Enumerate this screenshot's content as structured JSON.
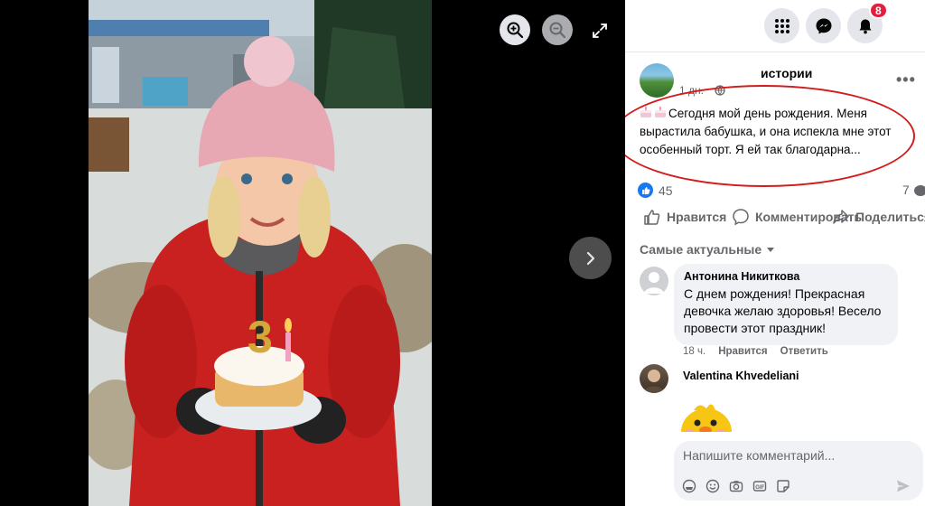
{
  "viewer": {
    "zoom_in_icon": "zoom-in-icon",
    "zoom_out_icon": "zoom-out-icon",
    "expand_icon": "expand-icon",
    "next_icon": "chevron-right-icon"
  },
  "topbar": {
    "menu_icon": "grid-menu-icon",
    "messenger_icon": "messenger-icon",
    "notifications_icon": "bell-icon",
    "notifications_count": "8"
  },
  "post": {
    "title": "истории",
    "time": "1 дн.",
    "text": "Сегодня мой день рождения. Меня вырастила бабушка, и она испекла мне этот особенный торт. Я ей так благодарна...",
    "more": "•••",
    "likes": "45",
    "comments_count": "7"
  },
  "actions": {
    "like": "Нравится",
    "comment": "Комментировать",
    "share": "Поделиться"
  },
  "comments": {
    "sort_label": "Самые актуальные",
    "items": [
      {
        "author": "Антонина Никиткова",
        "text": "С днем рождения! Прекрасная девочка желаю здоровья! Весело провести этот праздник!",
        "time": "18 ч.",
        "like": "Нравится",
        "reply": "Ответить"
      },
      {
        "author": "Valentina Khvedeliani"
      }
    ]
  },
  "composer": {
    "placeholder": "Напишите комментарий..."
  },
  "colors": {
    "accent": "#1877f2",
    "badge": "#e41e3f",
    "highlight": "#d31b1b"
  }
}
